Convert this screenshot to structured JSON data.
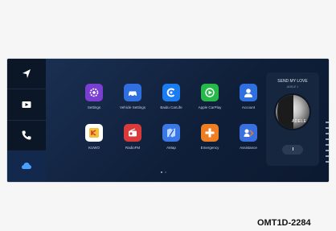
{
  "apps": [
    {
      "label": "Settings",
      "icon": "settings-icon",
      "color": "#7a3ed1"
    },
    {
      "label": "Vehicle Settings",
      "icon": "car-icon",
      "color": "#2f6fe0"
    },
    {
      "label": "Baidu CarLife",
      "icon": "carlife-icon",
      "color": "#1a7cf0"
    },
    {
      "label": "Apple CarPlay",
      "icon": "carplay-icon",
      "color": "#26b84a"
    },
    {
      "label": "Account",
      "icon": "user-icon",
      "color": "#2f6fe0"
    },
    {
      "label": "KUWO",
      "icon": "kuwo-icon",
      "color": "#f2c230"
    },
    {
      "label": "RadioFM",
      "icon": "radio-icon",
      "color": "#d93a3a"
    },
    {
      "label": "AMap",
      "icon": "map-icon",
      "color": "#3a78e8"
    },
    {
      "label": "Emergency",
      "icon": "emergency-icon",
      "color": "#ee7e23"
    },
    {
      "label": "Assistance",
      "icon": "assistance-icon",
      "color": "#3a6fe0"
    }
  ],
  "sidebar": [
    {
      "name": "navigation",
      "icon": "navigation-arrow-icon"
    },
    {
      "name": "media",
      "icon": "media-player-icon"
    },
    {
      "name": "phone",
      "icon": "phone-icon"
    },
    {
      "name": "cloud",
      "icon": "cloud-icon",
      "active": true
    }
  ],
  "music": {
    "title": "SEND MY LOVE",
    "artist": "ADELE 1",
    "album_text": "ADELE",
    "pause_symbol": "II"
  },
  "pagination": {
    "pages": 2,
    "current": 1
  },
  "image_code": "OMT1D-2284"
}
